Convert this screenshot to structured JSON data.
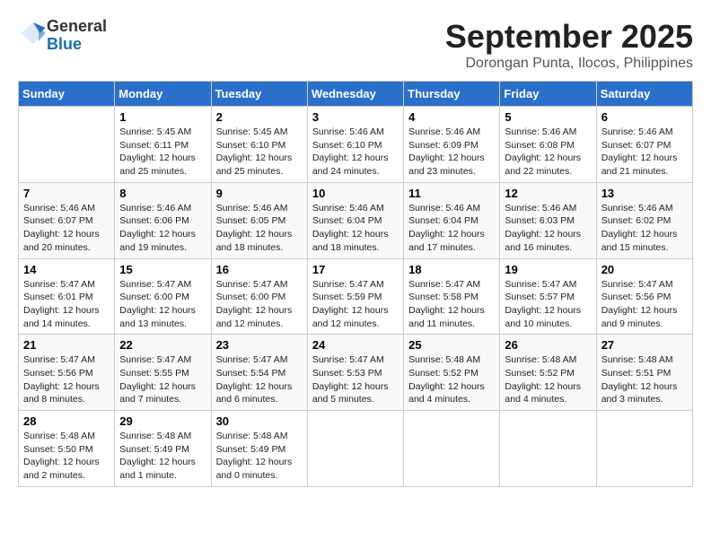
{
  "header": {
    "logo_general": "General",
    "logo_blue": "Blue",
    "month_title": "September 2025",
    "location": "Dorongan Punta, Ilocos, Philippines"
  },
  "days_of_week": [
    "Sunday",
    "Monday",
    "Tuesday",
    "Wednesday",
    "Thursday",
    "Friday",
    "Saturday"
  ],
  "weeks": [
    [
      {
        "date": "",
        "info": ""
      },
      {
        "date": "1",
        "info": "Sunrise: 5:45 AM\nSunset: 6:11 PM\nDaylight: 12 hours\nand 25 minutes."
      },
      {
        "date": "2",
        "info": "Sunrise: 5:45 AM\nSunset: 6:10 PM\nDaylight: 12 hours\nand 25 minutes."
      },
      {
        "date": "3",
        "info": "Sunrise: 5:46 AM\nSunset: 6:10 PM\nDaylight: 12 hours\nand 24 minutes."
      },
      {
        "date": "4",
        "info": "Sunrise: 5:46 AM\nSunset: 6:09 PM\nDaylight: 12 hours\nand 23 minutes."
      },
      {
        "date": "5",
        "info": "Sunrise: 5:46 AM\nSunset: 6:08 PM\nDaylight: 12 hours\nand 22 minutes."
      },
      {
        "date": "6",
        "info": "Sunrise: 5:46 AM\nSunset: 6:07 PM\nDaylight: 12 hours\nand 21 minutes."
      }
    ],
    [
      {
        "date": "7",
        "info": "Sunrise: 5:46 AM\nSunset: 6:07 PM\nDaylight: 12 hours\nand 20 minutes."
      },
      {
        "date": "8",
        "info": "Sunrise: 5:46 AM\nSunset: 6:06 PM\nDaylight: 12 hours\nand 19 minutes."
      },
      {
        "date": "9",
        "info": "Sunrise: 5:46 AM\nSunset: 6:05 PM\nDaylight: 12 hours\nand 18 minutes."
      },
      {
        "date": "10",
        "info": "Sunrise: 5:46 AM\nSunset: 6:04 PM\nDaylight: 12 hours\nand 18 minutes."
      },
      {
        "date": "11",
        "info": "Sunrise: 5:46 AM\nSunset: 6:04 PM\nDaylight: 12 hours\nand 17 minutes."
      },
      {
        "date": "12",
        "info": "Sunrise: 5:46 AM\nSunset: 6:03 PM\nDaylight: 12 hours\nand 16 minutes."
      },
      {
        "date": "13",
        "info": "Sunrise: 5:46 AM\nSunset: 6:02 PM\nDaylight: 12 hours\nand 15 minutes."
      }
    ],
    [
      {
        "date": "14",
        "info": "Sunrise: 5:47 AM\nSunset: 6:01 PM\nDaylight: 12 hours\nand 14 minutes."
      },
      {
        "date": "15",
        "info": "Sunrise: 5:47 AM\nSunset: 6:00 PM\nDaylight: 12 hours\nand 13 minutes."
      },
      {
        "date": "16",
        "info": "Sunrise: 5:47 AM\nSunset: 6:00 PM\nDaylight: 12 hours\nand 12 minutes."
      },
      {
        "date": "17",
        "info": "Sunrise: 5:47 AM\nSunset: 5:59 PM\nDaylight: 12 hours\nand 12 minutes."
      },
      {
        "date": "18",
        "info": "Sunrise: 5:47 AM\nSunset: 5:58 PM\nDaylight: 12 hours\nand 11 minutes."
      },
      {
        "date": "19",
        "info": "Sunrise: 5:47 AM\nSunset: 5:57 PM\nDaylight: 12 hours\nand 10 minutes."
      },
      {
        "date": "20",
        "info": "Sunrise: 5:47 AM\nSunset: 5:56 PM\nDaylight: 12 hours\nand 9 minutes."
      }
    ],
    [
      {
        "date": "21",
        "info": "Sunrise: 5:47 AM\nSunset: 5:56 PM\nDaylight: 12 hours\nand 8 minutes."
      },
      {
        "date": "22",
        "info": "Sunrise: 5:47 AM\nSunset: 5:55 PM\nDaylight: 12 hours\nand 7 minutes."
      },
      {
        "date": "23",
        "info": "Sunrise: 5:47 AM\nSunset: 5:54 PM\nDaylight: 12 hours\nand 6 minutes."
      },
      {
        "date": "24",
        "info": "Sunrise: 5:47 AM\nSunset: 5:53 PM\nDaylight: 12 hours\nand 5 minutes."
      },
      {
        "date": "25",
        "info": "Sunrise: 5:48 AM\nSunset: 5:52 PM\nDaylight: 12 hours\nand 4 minutes."
      },
      {
        "date": "26",
        "info": "Sunrise: 5:48 AM\nSunset: 5:52 PM\nDaylight: 12 hours\nand 4 minutes."
      },
      {
        "date": "27",
        "info": "Sunrise: 5:48 AM\nSunset: 5:51 PM\nDaylight: 12 hours\nand 3 minutes."
      }
    ],
    [
      {
        "date": "28",
        "info": "Sunrise: 5:48 AM\nSunset: 5:50 PM\nDaylight: 12 hours\nand 2 minutes."
      },
      {
        "date": "29",
        "info": "Sunrise: 5:48 AM\nSunset: 5:49 PM\nDaylight: 12 hours\nand 1 minute."
      },
      {
        "date": "30",
        "info": "Sunrise: 5:48 AM\nSunset: 5:49 PM\nDaylight: 12 hours\nand 0 minutes."
      },
      {
        "date": "",
        "info": ""
      },
      {
        "date": "",
        "info": ""
      },
      {
        "date": "",
        "info": ""
      },
      {
        "date": "",
        "info": ""
      }
    ]
  ]
}
